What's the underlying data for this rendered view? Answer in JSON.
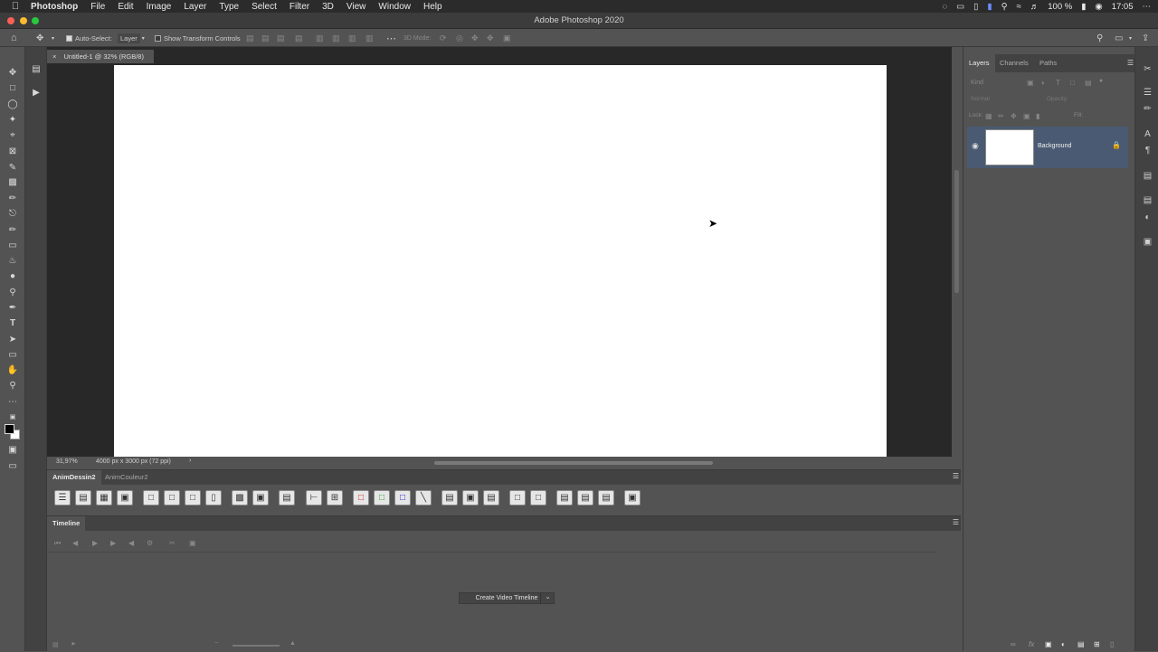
{
  "menubar": {
    "apple": "",
    "items": [
      "Photoshop",
      "File",
      "Edit",
      "Image",
      "Layer",
      "Type",
      "Select",
      "Filter",
      "3D",
      "View",
      "Window",
      "Help"
    ],
    "battery": "100 %",
    "time": "17:05"
  },
  "window": {
    "title": "Adobe Photoshop 2020"
  },
  "options": {
    "auto_select_label": "Auto-Select:",
    "auto_select_value": "Layer",
    "transform_label": "Show Transform Controls",
    "mode_3d_label": "3D Mode:"
  },
  "document": {
    "tab_title": "Untitled-1 @ 32% (RGB/8)",
    "zoom": "31,97%",
    "size_info": "4000 px x 3000 px (72 ppi)"
  },
  "anim_panel": {
    "tabs": [
      "AnimDessin2",
      "AnimCouleur2"
    ]
  },
  "timeline": {
    "title": "Timeline",
    "create_button": "Create Video Timeline"
  },
  "layers_panel": {
    "tabs": [
      "Layers",
      "Channels",
      "Paths"
    ],
    "kind_placeholder": "Kind",
    "blend_mode": "Normal",
    "opacity_label": "Opacity:",
    "lock_label": "Lock:",
    "fill_label": "Fill:",
    "layer_name": "Background"
  },
  "colors": {
    "accent": "#4a5a72",
    "canvas": "#ffffff"
  }
}
